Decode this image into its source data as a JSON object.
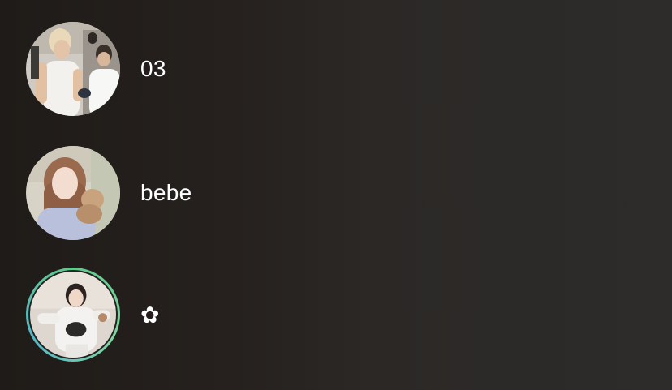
{
  "contacts": [
    {
      "name": "03",
      "avatar_icon": "person-photo-icon"
    },
    {
      "name": "bebe",
      "avatar_icon": "person-photo-icon"
    },
    {
      "name": "✿",
      "avatar_icon": "person-photo-icon",
      "ring_color": "#5fc98a"
    }
  ],
  "colors": {
    "background_left": "#1f1b18",
    "background_right": "#2d2c2b",
    "text": "#ffffff",
    "story_ring": "#5fc98a"
  }
}
